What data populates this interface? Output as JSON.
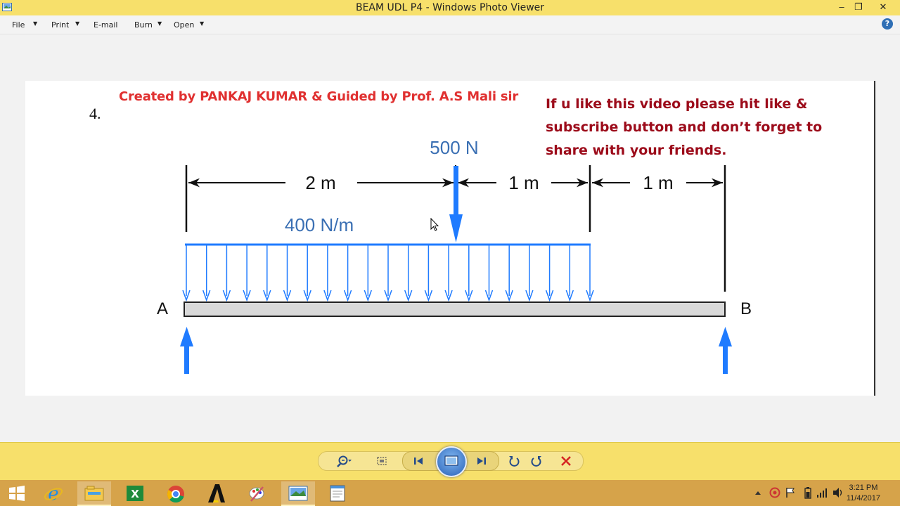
{
  "window": {
    "title": "BEAM UDL P4 - Windows Photo Viewer",
    "minimize": "–",
    "maximize": "❐",
    "close": "✕"
  },
  "menu": {
    "items": [
      {
        "label": "File"
      },
      {
        "label": "Print"
      },
      {
        "label": "E-mail"
      },
      {
        "label": "Burn"
      },
      {
        "label": "Open"
      }
    ],
    "help": "?"
  },
  "slide": {
    "question_number": "4.",
    "credit": "Created by PANKAJ KUMAR & Guided by Prof. A.S Mali sir",
    "cta_lines": [
      "If u like this video please hit like &",
      "subscribe button and don’t forget to",
      "share with your friends."
    ]
  },
  "diagram": {
    "point_load": "500 N",
    "udl": "400 N/m",
    "dim_1": "2 m",
    "dim_2": "1 m",
    "dim_3": "1 m",
    "support_left": "A",
    "support_right": "B",
    "colors": {
      "arrow_blue": "#1f7bff",
      "beam_fill": "#d9d9d9",
      "beam_stroke": "#222222"
    }
  },
  "controls": [
    {
      "icon": "zoom-icon"
    },
    {
      "icon": "actual-size-icon"
    },
    {
      "icon": "previous-icon"
    },
    {
      "icon": "slideshow-icon"
    },
    {
      "icon": "next-icon"
    },
    {
      "icon": "rotate-counterclockwise-icon"
    },
    {
      "icon": "rotate-clockwise-icon"
    },
    {
      "icon": "delete-icon"
    }
  ],
  "taskbar": {
    "apps": [
      "start-icon",
      "internet-explorer-icon",
      "file-explorer-icon",
      "excel-icon",
      "chrome-icon",
      "autocad-icon",
      "paint-icon",
      "photo-viewer-icon",
      "notepad-icon"
    ],
    "time": "3:21 PM",
    "date": "11/4/2017"
  }
}
